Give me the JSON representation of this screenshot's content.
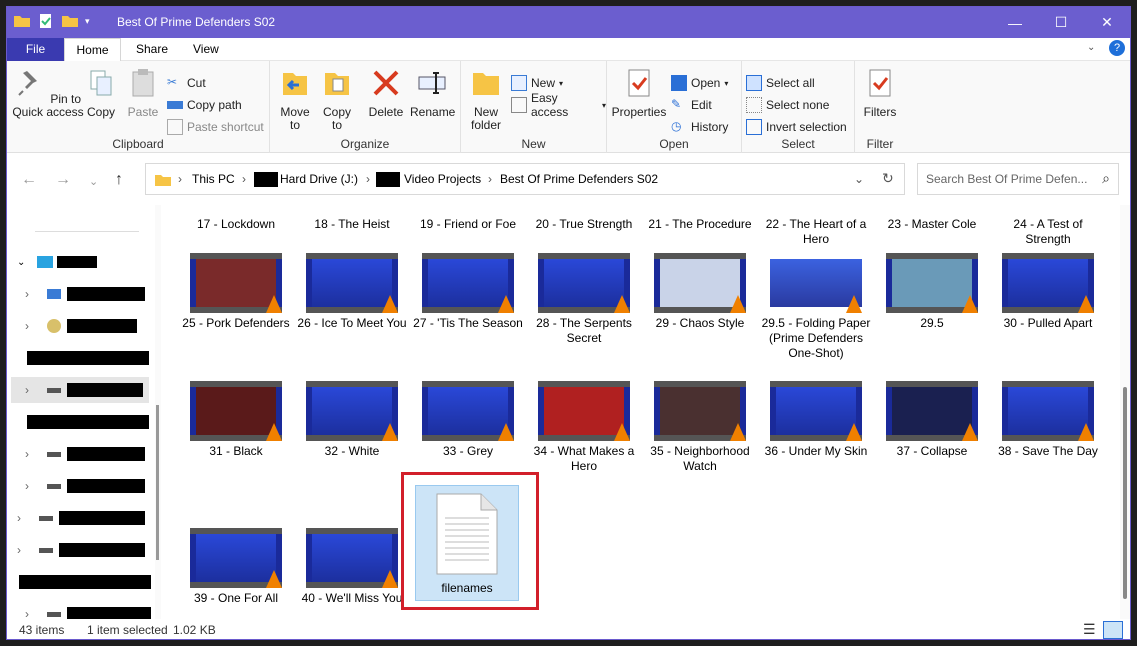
{
  "window": {
    "title": "Best Of Prime Defenders S02"
  },
  "menu": {
    "file": "File",
    "home": "Home",
    "share": "Share",
    "view": "View"
  },
  "ribbon": {
    "clipboard": {
      "label": "Clipboard",
      "pin": "Pin to Quick access",
      "copy": "Copy",
      "paste": "Paste",
      "cut": "Cut",
      "copy_path": "Copy path",
      "paste_shortcut": "Paste shortcut"
    },
    "organize": {
      "label": "Organize",
      "move_to": "Move to",
      "copy_to": "Copy to",
      "delete": "Delete",
      "rename": "Rename"
    },
    "new": {
      "label": "New",
      "new_folder": "New folder",
      "new_item": "New",
      "easy_access": "Easy access"
    },
    "open": {
      "label": "Open",
      "properties": "Properties",
      "open": "Open",
      "edit": "Edit",
      "history": "History"
    },
    "select": {
      "label": "Select",
      "select_all": "Select all",
      "select_none": "Select none",
      "invert": "Invert selection"
    },
    "filter": {
      "label": "Filter",
      "filters": "Filters"
    }
  },
  "address": {
    "crumbs": [
      "This PC",
      "Hard Drive (J:)",
      "Video Projects",
      "Best Of Prime Defenders S02"
    ],
    "search_placeholder": "Search Best Of Prime Defen..."
  },
  "files": {
    "row0": [
      "17 - Lockdown",
      "18 - The Heist",
      "19 - Friend or Foe",
      "20 - True Strength",
      "21 - The Procedure",
      "22 - The Heart of a Hero",
      "23 - Master Cole",
      "24 - A Test of Strength"
    ],
    "row1": [
      "25 - Pork Defenders",
      "26 - Ice To Meet You",
      "27 - 'Tis The Season",
      "28 - The Serpents Secret",
      "29 - Chaos Style",
      "29.5 - Folding Paper (Prime Defenders One-Shot)",
      "29.5",
      "30 - Pulled Apart"
    ],
    "row2": [
      "31 - Black",
      "32 - White",
      "33 - Grey",
      "34 - What Makes a Hero",
      "35 - Neighborhood Watch",
      "36 - Under My Skin",
      "37 - Collapse",
      "38 - Save The Day"
    ],
    "row3": [
      "39 - One For All",
      "40 - We'll Miss You"
    ],
    "selected": "filenames"
  },
  "status": {
    "count": "43 items",
    "selected": "1 item selected",
    "size": "1.02 KB"
  },
  "colors": {
    "title_bar": "#6b5ecf",
    "file_tab": "#3a3ab0",
    "selection": "#cce4f7",
    "highlight": "#d21f2a"
  }
}
